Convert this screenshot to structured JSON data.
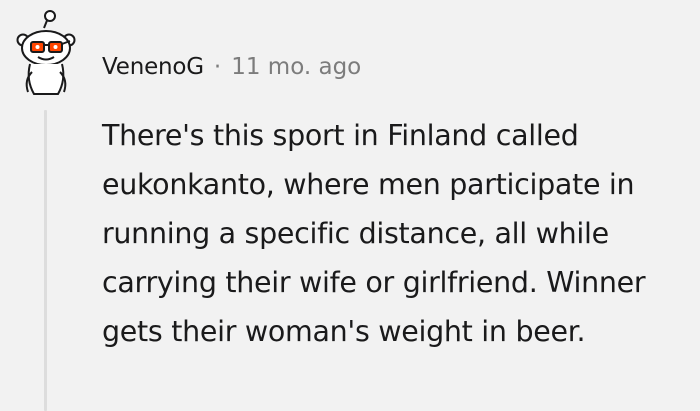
{
  "comment": {
    "username": "VenenoG",
    "separator": "·",
    "timestamp": "11 mo. ago",
    "avatar_icon": "snoo-avatar-icon",
    "body": "There's this sport in Finland called eukonkanto, where men participate in running a specific distance, all while carrying their wife or girlfriend. Winner gets their woman's weight in beer."
  },
  "colors": {
    "background": "#f2f2f2",
    "text": "#1a1a1b",
    "meta": "#7c7c7c",
    "thread_line": "#dddddd",
    "avatar_accent": "#ff4500"
  }
}
